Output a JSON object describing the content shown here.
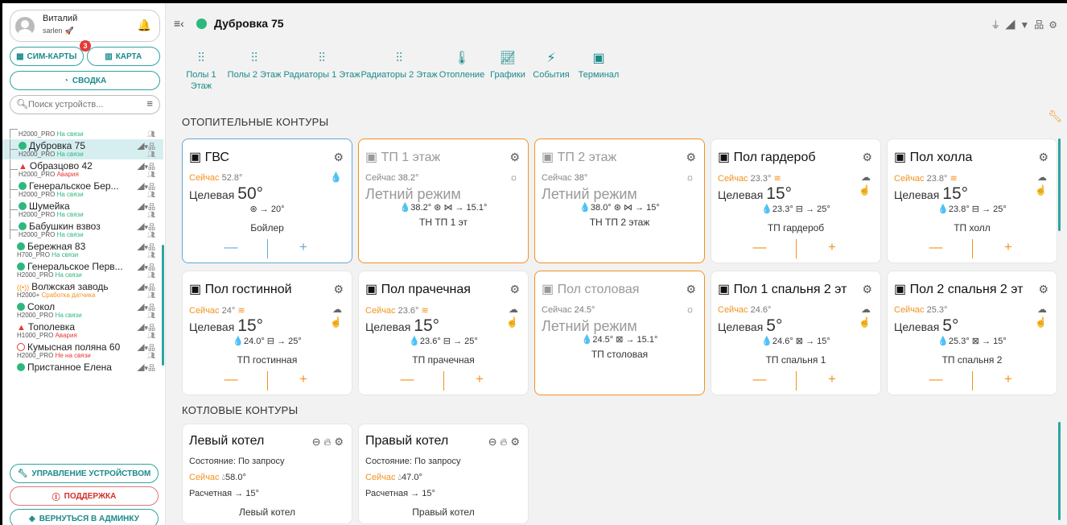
{
  "user": {
    "name": "Виталий",
    "login": "sarlen"
  },
  "buttons": {
    "sim": "СИМ-КАРТЫ",
    "sim_badge": "3",
    "map": "КАРТА",
    "summary": "СВОДКА",
    "manage": "УПРАВЛЕНИЕ УСТРОЙСТВОМ",
    "support": "ПОДДЕРЖКА",
    "admin": "ВЕРНУТЬСЯ В АДМИНКУ"
  },
  "search": {
    "placeholder": "Поиск устройств..."
  },
  "devices": [
    {
      "name": "",
      "type": "H2000_PRO",
      "status": "На связи",
      "state": "ok",
      "marker": "none",
      "tree": true
    },
    {
      "name": "Дубровка 75",
      "type": "H2000_PRO",
      "status": "На связи",
      "state": "ok",
      "marker": "dot",
      "tree": true,
      "selected": true
    },
    {
      "name": "Образцово 42",
      "type": "H2000_PRO",
      "status": "Авария",
      "state": "al",
      "marker": "tri",
      "tree": true
    },
    {
      "name": "Генеральское Бер...",
      "type": "H2000_PRO",
      "status": "На связи",
      "state": "ok",
      "marker": "dot",
      "tree": true
    },
    {
      "name": "Шумейка",
      "type": "H2000_PRO",
      "status": "На связи",
      "state": "ok",
      "marker": "dot",
      "tree": true
    },
    {
      "name": "Бабушкин взвоз",
      "type": "H2000_PRO",
      "status": "На связи",
      "state": "ok",
      "marker": "dot",
      "tree": true
    },
    {
      "name": "Бережная 83",
      "type": "H700_PRO",
      "status": "На связи",
      "state": "ok",
      "marker": "dot",
      "tree": false
    },
    {
      "name": "Генеральское Перв...",
      "type": "H2000_PRO",
      "status": "На связи",
      "state": "ok",
      "marker": "dot",
      "tree": false
    },
    {
      "name": "Волжская заводь",
      "type": "H2000+",
      "status": "Сработка датчика",
      "state": "wn",
      "marker": "sig",
      "tree": false
    },
    {
      "name": "Сокол",
      "type": "H2000_PRO",
      "status": "На связи",
      "state": "ok",
      "marker": "dot",
      "tree": false
    },
    {
      "name": "Тополевка",
      "type": "H1000_PRO",
      "status": "Авария",
      "state": "al",
      "marker": "tri",
      "tree": false
    },
    {
      "name": "Кумысная поляна 60",
      "type": "H2000_PRO",
      "status": "Не на связи",
      "state": "al",
      "marker": "ring",
      "tree": false
    },
    {
      "name": "Пристанное Елена",
      "type": "",
      "status": "",
      "state": "ok",
      "marker": "dot",
      "tree": false
    }
  ],
  "header": {
    "title": "Дубровка 75"
  },
  "tabs": [
    {
      "label": "Полы 1 Этаж",
      "icon": "sliders-icon"
    },
    {
      "label": "Полы 2 Этаж",
      "icon": "sliders-icon"
    },
    {
      "label": "Радиаторы 1 Этаж",
      "icon": "sliders-icon"
    },
    {
      "label": "Радиаторы 2 Этаж",
      "icon": "sliders-icon"
    },
    {
      "label": "Отопление",
      "icon": "thermometer-icon"
    },
    {
      "label": "Графики",
      "icon": "chart-icon"
    },
    {
      "label": "События",
      "icon": "lightning-icon"
    },
    {
      "label": "Терминал",
      "icon": "terminal-icon"
    }
  ],
  "sections": {
    "heating": "ОТОПИТЕЛЬНЫЕ КОНТУРЫ",
    "boilers": "КОТЛОВЫЕ КОНТУРЫ"
  },
  "labels": {
    "now": "Сейчас",
    "target": "Целевая",
    "state": "Состояние:",
    "calc": "Расчетная"
  },
  "circuits": [
    {
      "name": "ГВС",
      "style": "blue",
      "now": "52.8°",
      "target": "50°",
      "info": "⊛ → 20°",
      "device": "Бойлер",
      "mode": "normal",
      "icon1": "💧",
      "icon2": "",
      "col": 0,
      "row": 0,
      "nowicon": ""
    },
    {
      "name": "ТП 1 этаж",
      "style": "orange dim",
      "now": "38.2°",
      "summer": "Летний режим",
      "info": "💧38.2° ⊛ ⋈ → 15.1°",
      "device": "ТН ТП 1 эт",
      "mode": "summer",
      "icon1": "☼",
      "icon2": "",
      "col": 1,
      "row": 0,
      "nowicon": ""
    },
    {
      "name": "ТП 2 этаж",
      "style": "orange dim",
      "now": "38°",
      "summer": "Летний режим",
      "info": "💧38.0° ⊛ ⋈ → 15°",
      "device": "ТН ТП 2 этаж",
      "mode": "summer",
      "icon1": "☼",
      "icon2": "",
      "col": 2,
      "row": 0,
      "nowicon": ""
    },
    {
      "name": "Пол гардероб",
      "style": "",
      "now": "23.3°",
      "target": "15°",
      "info": "💧23.3° ⊟ → 25°",
      "device": "ТП гардероб",
      "mode": "normal",
      "icon1": "☁",
      "icon2": "☝",
      "col": 3,
      "row": 0,
      "nowicon": "≋"
    },
    {
      "name": "Пол холла",
      "style": "",
      "now": "23.8°",
      "target": "15°",
      "info": "💧23.8° ⊟ → 25°",
      "device": "ТП холл",
      "mode": "normal",
      "icon1": "☁",
      "icon2": "☝",
      "col": 4,
      "row": 0,
      "nowicon": "≋"
    },
    {
      "name": "Пол гостинной",
      "style": "",
      "now": "24°",
      "target": "15°",
      "info": "💧24.0° ⊟ → 25°",
      "device": "ТП гостинная",
      "mode": "normal",
      "icon1": "☁",
      "icon2": "☝",
      "col": 0,
      "row": 1,
      "nowicon": "≋"
    },
    {
      "name": "Пол прачечная",
      "style": "",
      "now": "23.6°",
      "target": "15°",
      "info": "💧23.6° ⊟ → 25°",
      "device": "ТП прачечная",
      "mode": "normal",
      "icon1": "☁",
      "icon2": "☝",
      "col": 1,
      "row": 1,
      "nowicon": "≋"
    },
    {
      "name": "Пол столовая",
      "style": "orange dim",
      "now": "24.5°",
      "summer": "Летний режим",
      "info": "💧24.5° ⊠ → 15.1°",
      "device": "ТП столовая",
      "mode": "summer",
      "icon1": "☼",
      "icon2": "",
      "col": 2,
      "row": 1,
      "nowicon": ""
    },
    {
      "name": "Пол 1 спальня 2 эт",
      "style": "",
      "now": "24.6°",
      "target": "5°",
      "info": "💧24.6° ⊠ → 15°",
      "device": "ТП спальня 1",
      "mode": "normal",
      "icon1": "☁",
      "icon2": "☝",
      "col": 3,
      "row": 1,
      "nowicon": ""
    },
    {
      "name": "Пол 2 спальня 2 эт",
      "style": "",
      "now": "25.3°",
      "target": "5°",
      "info": "💧25.3° ⊠ → 15°",
      "device": "ТП спальня 2",
      "mode": "normal",
      "icon1": "☁",
      "icon2": "☝",
      "col": 4,
      "row": 1,
      "nowicon": ""
    }
  ],
  "boilers": [
    {
      "name": "Левый котел",
      "state": "По запросу",
      "now": "58.0°",
      "calc": "15°",
      "device": "Левый котел"
    },
    {
      "name": "Правый котел",
      "state": "По запросу",
      "now": "47.0°",
      "calc": "15°",
      "device": "Правый котел"
    }
  ],
  "colors": {
    "accent": "#1a8a8a",
    "orange": "#f4911e",
    "online": "#2db87d",
    "alarm": "#e53935",
    "blue": "#64a8d8"
  }
}
